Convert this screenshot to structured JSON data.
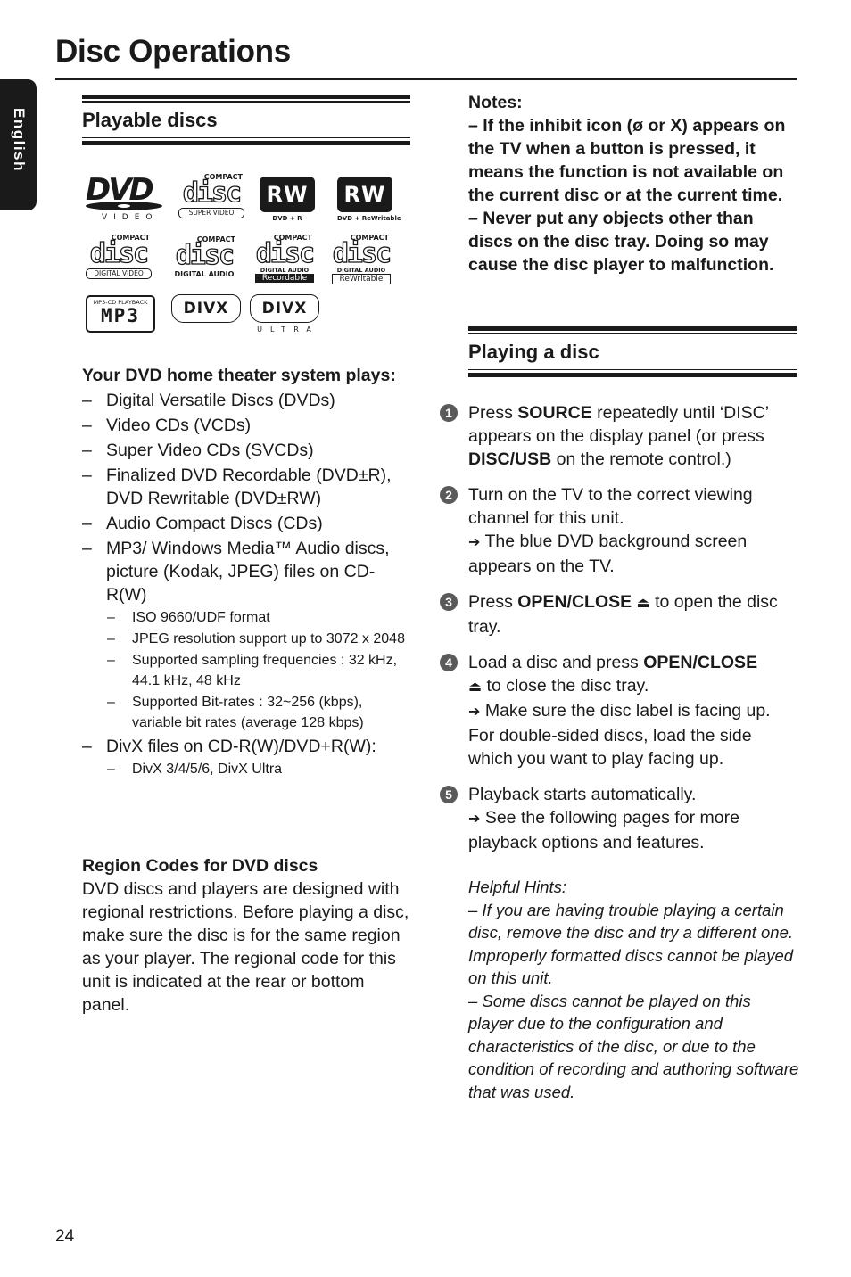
{
  "page": {
    "title": "Disc Operations",
    "language_tab": "English",
    "page_number": "24"
  },
  "playable_discs": {
    "heading": "Playable discs",
    "logos": [
      {
        "name": "dvd-video-logo",
        "main": "DVD",
        "sub": "VIDEO"
      },
      {
        "name": "super-video-cd-logo",
        "top": "COMPACT",
        "main": "disc",
        "sub": "SUPER VIDEO"
      },
      {
        "name": "dvd-plus-r-logo",
        "main": "RW",
        "sub": "DVD + R"
      },
      {
        "name": "dvd-plus-rewritable-logo",
        "main": "RW",
        "sub": "DVD + ReWritable"
      },
      {
        "name": "cd-digital-video-logo",
        "top": "COMPACT",
        "main": "disc",
        "sub": "DIGITAL VIDEO"
      },
      {
        "name": "cd-digital-audio-logo",
        "top": "COMPACT",
        "main": "disc",
        "sub": "DIGITAL AUDIO"
      },
      {
        "name": "cd-recordable-logo",
        "top": "COMPACT",
        "main": "disc",
        "sub": "DIGITAL AUDIO",
        "sub2": "Recordable"
      },
      {
        "name": "cd-rewritable-logo",
        "top": "COMPACT",
        "main": "disc",
        "sub": "DIGITAL AUDIO",
        "sub2": "ReWritable"
      },
      {
        "name": "mp3-cd-logo",
        "top": "MP3-CD PLAYBACK",
        "main": "MP3"
      },
      {
        "name": "divx-logo",
        "main": "DIVX"
      },
      {
        "name": "divx-ultra-logo",
        "main": "DIVX",
        "sub": "ULTRA"
      }
    ],
    "plays_heading": "Your DVD home theater system plays:",
    "items": [
      {
        "text": "Digital Versatile Discs (DVDs)"
      },
      {
        "text": "Video CDs (VCDs)"
      },
      {
        "text": "Super Video CDs (SVCDs)"
      },
      {
        "text": "Finalized DVD Recordable (DVD±R), DVD Rewritable (DVD±RW)"
      },
      {
        "text": "Audio Compact Discs (CDs)"
      },
      {
        "text": "MP3/ Windows Media™ Audio discs, picture (Kodak, JPEG) files on CD-R(W)",
        "sub": [
          "ISO 9660/UDF format",
          "JPEG resolution support up to 3072 x 2048",
          "Supported sampling frequencies : 32 kHz, 44.1 kHz, 48 kHz",
          "Supported Bit-rates : 32~256 (kbps), variable bit rates (average 128 kbps)"
        ]
      },
      {
        "text": "DivX files on CD-R(W)/DVD+R(W):",
        "sub": [
          "DivX 3/4/5/6, DivX Ultra"
        ]
      }
    ],
    "dash": "–",
    "region_heading": "Region Codes for DVD discs",
    "region_text": "DVD discs and players are designed with regional restrictions. Before playing a disc, make sure the disc is for the same region as your player.  The regional code for this unit is indicated at the rear or bottom panel."
  },
  "notes": {
    "heading": "Notes:",
    "items": [
      "– If the inhibit icon (ø or X) appears on the TV when a button is pressed, it means the function is not available on the current disc or at the current time.",
      "– Never put any objects other than discs on the disc tray.  Doing so may cause the disc player to malfunction."
    ]
  },
  "playing_disc": {
    "heading": "Playing a disc",
    "arrow": "➔",
    "eject": "⏏",
    "steps": [
      {
        "num": "1",
        "pre": "Press ",
        "b1": "SOURCE",
        "mid": " repeatedly until ‘DISC’ appears on the display panel (or press ",
        "b2": "DISC/USB",
        "post": " on the remote control.)"
      },
      {
        "num": "2",
        "text": "Turn on the TV to the correct viewing channel for this unit.",
        "result": "The blue DVD background screen appears on the TV."
      },
      {
        "num": "3",
        "pre": "Press ",
        "b1": "OPEN/CLOSE",
        "post": " to open the disc tray."
      },
      {
        "num": "4",
        "pre": "Load a disc and press ",
        "b1": "OPEN/CLOSE",
        "post": " to close the disc tray.",
        "result": "Make sure the disc label is facing up. For double-sided discs, load the side which you want to play facing up."
      },
      {
        "num": "5",
        "text": "Playback starts automatically.",
        "result": "See the following pages for more playback options and features."
      }
    ]
  },
  "hints": {
    "heading": "Helpful Hints:",
    "items": [
      "– If you are having trouble playing a certain disc, remove the disc and try a different one. Improperly formatted discs cannot be played on this unit.",
      "– Some discs cannot be played on this player due to the configuration and characteristics of the disc, or due to the condition of recording and authoring software that was used."
    ]
  }
}
